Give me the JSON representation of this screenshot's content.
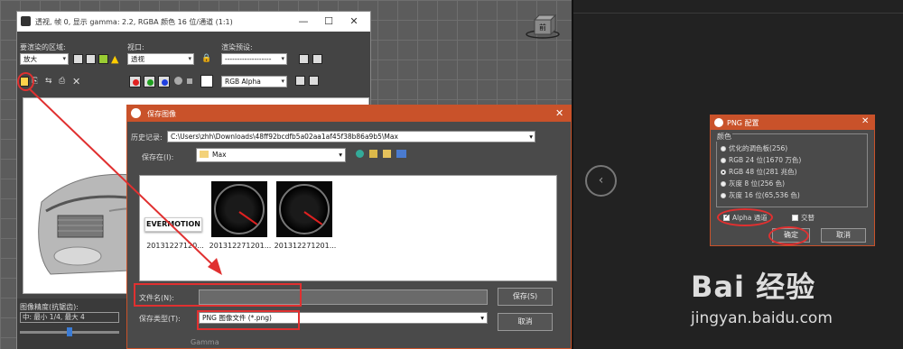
{
  "render_window": {
    "title": "透视, 帧 0, 显示 gamma: 2.2, RGBA 颜色 16 位/通道 (1:1)",
    "area_label": "要渲染的区域:",
    "area_value": "放大",
    "viewport_label": "视口:",
    "viewport_value": "透视",
    "preset_label": "渲染预设:",
    "preset_value": "-------------------",
    "channel_value": "RGB Alpha",
    "precision_label": "图像精度(抗锯齿):",
    "precision_value": "中: 最小 1/4, 最大 4",
    "bottom_partial": "Gamma",
    "car_plate": "EVERMOTION"
  },
  "view_cube_label": "前",
  "save_dialog": {
    "title": "保存图像",
    "history_label": "历史记录:",
    "history_value": "C:\\Users\\zhh\\Downloads\\48ff92bcdfb5a02aa1af45f38b86a9b5\\Max",
    "save_in_label": "保存在(I):",
    "save_in_value": "Max",
    "files": [
      {
        "name": "20131227120...",
        "kind": "evermotion",
        "text": "EVERMOTION"
      },
      {
        "name": "201312271201...",
        "kind": "gauge"
      },
      {
        "name": "201312271201...",
        "kind": "gauge"
      }
    ],
    "filename_label": "文件名(N):",
    "filename_value": "",
    "filetype_label": "保存类型(T):",
    "filetype_value": "PNG 图像文件 (*.png)",
    "save_button": "保存(S)",
    "cancel_button": "取消"
  },
  "png_dialog": {
    "title": "PNG 配置",
    "group_label": "颜色",
    "options": [
      {
        "label": "优化的调色板(256)",
        "selected": false
      },
      {
        "label": "RGB 24 位(1670 万色)",
        "selected": false
      },
      {
        "label": "RGB 48 位(281 兆色)",
        "selected": true
      },
      {
        "label": "灰度 8 位(256 色)",
        "selected": false
      },
      {
        "label": "灰度 16 位(65,536 色)",
        "selected": false
      }
    ],
    "alpha_label": "Alpha 通道",
    "alpha_checked": true,
    "interlace_label": "交替",
    "interlace_checked": false,
    "ok_button": "确定",
    "cancel_button": "取消"
  },
  "nav_prev_icon": "chevron-left-icon",
  "watermark": {
    "brand": "Bai 经验",
    "domain": "jingyan.baidu.com"
  },
  "colors": {
    "dialog_accent": "#c9522a",
    "annotation_red": "#e03030"
  }
}
